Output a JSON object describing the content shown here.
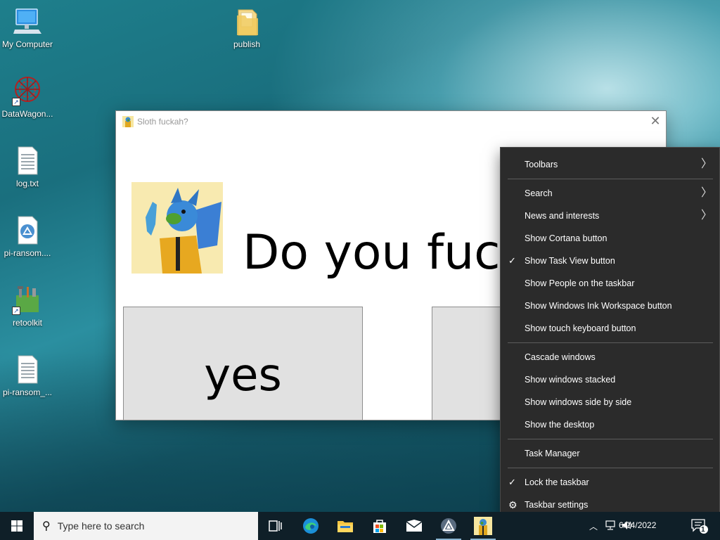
{
  "desktop": {
    "icons": [
      {
        "label": "My Computer",
        "icon": "computer-icon"
      },
      {
        "label": "DataWagon...",
        "icon": "datawagon-icon"
      },
      {
        "label": "log.txt",
        "icon": "text-file-icon"
      },
      {
        "label": "pi-ransom....",
        "icon": "app-file-icon"
      },
      {
        "label": "retoolkit",
        "icon": "toolkit-icon"
      },
      {
        "label": "pi-ransom_...",
        "icon": "text-file-icon"
      },
      {
        "label": "publish",
        "icon": "folder-icon"
      }
    ]
  },
  "app_window": {
    "title": "Sloth fuckah?",
    "question": "Do you fuck",
    "yes_label": "yes",
    "no_label": ""
  },
  "context_menu": {
    "items": [
      {
        "label": "Toolbars",
        "submenu": true,
        "checked": false
      },
      {
        "label": "Search",
        "submenu": true,
        "checked": false
      },
      {
        "label": "News and interests",
        "submenu": true,
        "checked": false
      },
      {
        "label": "Show Cortana button",
        "submenu": false,
        "checked": false
      },
      {
        "label": "Show Task View button",
        "submenu": false,
        "checked": true
      },
      {
        "label": "Show People on the taskbar",
        "submenu": false,
        "checked": false
      },
      {
        "label": "Show Windows Ink Workspace button",
        "submenu": false,
        "checked": false
      },
      {
        "label": "Show touch keyboard button",
        "submenu": false,
        "checked": false
      },
      {
        "label": "Cascade windows",
        "submenu": false,
        "checked": false
      },
      {
        "label": "Show windows stacked",
        "submenu": false,
        "checked": false
      },
      {
        "label": "Show windows side by side",
        "submenu": false,
        "checked": false
      },
      {
        "label": "Show the desktop",
        "submenu": false,
        "checked": false
      },
      {
        "label": "Task Manager",
        "submenu": false,
        "checked": false
      },
      {
        "label": "Lock the taskbar",
        "submenu": false,
        "checked": true
      },
      {
        "label": "Taskbar settings",
        "submenu": false,
        "checked": false
      }
    ]
  },
  "taskbar": {
    "search_placeholder": "Type here to search",
    "date": "6/24/2022",
    "notification_count": "1",
    "pinned": [
      "task-view-icon",
      "edge-icon",
      "file-explorer-icon",
      "store-icon",
      "mail-icon",
      "app-triangle-icon",
      "sloth-app-icon"
    ]
  },
  "colors": {
    "menu_bg": "#2b2b2b",
    "taskbar_bg": "#0f1f28",
    "button_bg": "#e1e1e1"
  }
}
